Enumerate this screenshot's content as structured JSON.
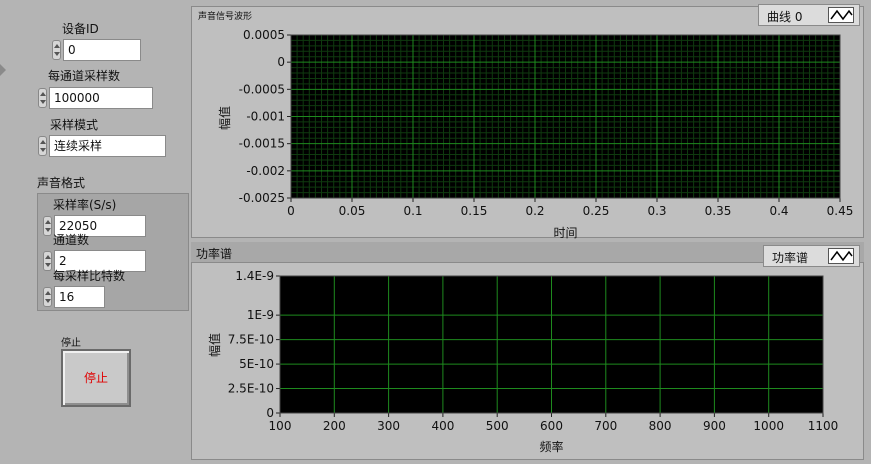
{
  "controls": {
    "device_id": {
      "label": "设备ID",
      "value": "0"
    },
    "samples_per_channel": {
      "label": "每通道采样数",
      "value": "100000"
    },
    "sample_mode": {
      "label": "采样模式",
      "value": "连续采样"
    },
    "sound_format": {
      "label": "声音格式",
      "sample_rate": {
        "label": "采样率(S/s)",
        "value": "22050"
      },
      "channels": {
        "label": "通道数",
        "value": "2"
      },
      "bits_per_sample": {
        "label": "每采样比特数",
        "value": "16"
      }
    },
    "stop": {
      "label": "停止",
      "button_text": "停止"
    }
  },
  "charts": {
    "waveform": {
      "panel_title": "声音信号波形",
      "legend_label": "曲线 0"
    },
    "power": {
      "panel_title": "功率谱",
      "legend_label": "功率谱"
    }
  },
  "colors": {
    "plot_bg": "#000000",
    "grid": "#1e8a1e",
    "grid_minor": "#0f3a0f",
    "stop_text": "#e00000"
  },
  "chart_data": [
    {
      "type": "line",
      "title": "",
      "xlabel": "时间",
      "ylabel": "幅值",
      "xlim": [
        0,
        0.45
      ],
      "ylim": [
        -0.0025,
        0.0005
      ],
      "x_ticks": [
        "0",
        "0.05",
        "0.1",
        "0.15",
        "0.2",
        "0.25",
        "0.3",
        "0.35",
        "0.4",
        "0.45"
      ],
      "y_ticks": [
        "0.0005",
        "0",
        "-0.0005",
        "-0.001",
        "-0.0015",
        "-0.002",
        "-0.0025"
      ],
      "minor_grid": true,
      "series": [
        {
          "name": "曲线 0",
          "values": []
        }
      ]
    },
    {
      "type": "line",
      "title": "",
      "xlabel": "频率",
      "ylabel": "幅值",
      "xlim": [
        100,
        1100
      ],
      "ylim": [
        0,
        1.4e-09
      ],
      "x_ticks": [
        "100",
        "200",
        "300",
        "400",
        "500",
        "600",
        "700",
        "800",
        "900",
        "1000",
        "1100"
      ],
      "y_ticks": [
        "1.4E-9",
        "1E-9",
        "7.5E-10",
        "5E-10",
        "2.5E-10",
        "0"
      ],
      "y_tick_values": [
        1.4e-09,
        1e-09,
        7.5e-10,
        5e-10,
        2.5e-10,
        0
      ],
      "minor_grid": false,
      "series": [
        {
          "name": "功率谱",
          "values": []
        }
      ]
    }
  ]
}
